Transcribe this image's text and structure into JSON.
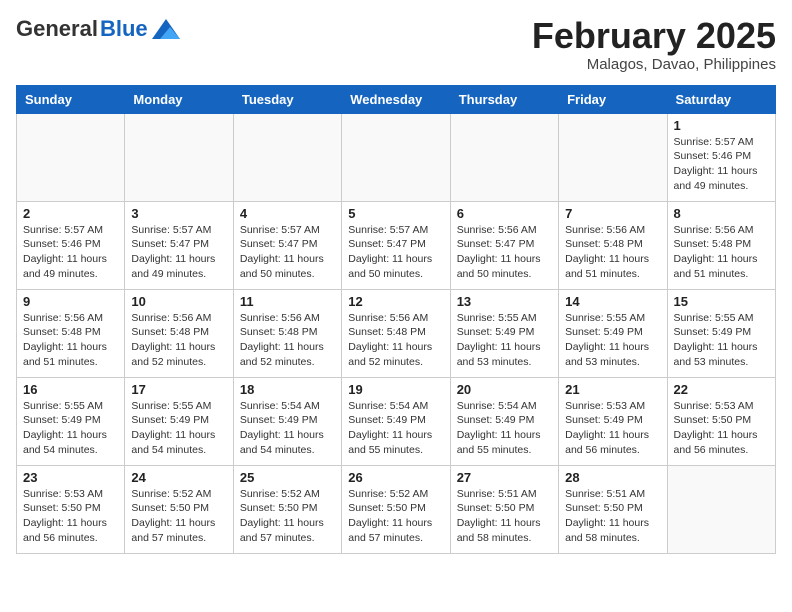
{
  "header": {
    "logo_general": "General",
    "logo_blue": "Blue",
    "month_title": "February 2025",
    "location": "Malagos, Davao, Philippines"
  },
  "weekdays": [
    "Sunday",
    "Monday",
    "Tuesday",
    "Wednesday",
    "Thursday",
    "Friday",
    "Saturday"
  ],
  "weeks": [
    [
      {
        "day": "",
        "info": ""
      },
      {
        "day": "",
        "info": ""
      },
      {
        "day": "",
        "info": ""
      },
      {
        "day": "",
        "info": ""
      },
      {
        "day": "",
        "info": ""
      },
      {
        "day": "",
        "info": ""
      },
      {
        "day": "1",
        "info": "Sunrise: 5:57 AM\nSunset: 5:46 PM\nDaylight: 11 hours\nand 49 minutes."
      }
    ],
    [
      {
        "day": "2",
        "info": "Sunrise: 5:57 AM\nSunset: 5:46 PM\nDaylight: 11 hours\nand 49 minutes."
      },
      {
        "day": "3",
        "info": "Sunrise: 5:57 AM\nSunset: 5:47 PM\nDaylight: 11 hours\nand 49 minutes."
      },
      {
        "day": "4",
        "info": "Sunrise: 5:57 AM\nSunset: 5:47 PM\nDaylight: 11 hours\nand 50 minutes."
      },
      {
        "day": "5",
        "info": "Sunrise: 5:57 AM\nSunset: 5:47 PM\nDaylight: 11 hours\nand 50 minutes."
      },
      {
        "day": "6",
        "info": "Sunrise: 5:56 AM\nSunset: 5:47 PM\nDaylight: 11 hours\nand 50 minutes."
      },
      {
        "day": "7",
        "info": "Sunrise: 5:56 AM\nSunset: 5:48 PM\nDaylight: 11 hours\nand 51 minutes."
      },
      {
        "day": "8",
        "info": "Sunrise: 5:56 AM\nSunset: 5:48 PM\nDaylight: 11 hours\nand 51 minutes."
      }
    ],
    [
      {
        "day": "9",
        "info": "Sunrise: 5:56 AM\nSunset: 5:48 PM\nDaylight: 11 hours\nand 51 minutes."
      },
      {
        "day": "10",
        "info": "Sunrise: 5:56 AM\nSunset: 5:48 PM\nDaylight: 11 hours\nand 52 minutes."
      },
      {
        "day": "11",
        "info": "Sunrise: 5:56 AM\nSunset: 5:48 PM\nDaylight: 11 hours\nand 52 minutes."
      },
      {
        "day": "12",
        "info": "Sunrise: 5:56 AM\nSunset: 5:48 PM\nDaylight: 11 hours\nand 52 minutes."
      },
      {
        "day": "13",
        "info": "Sunrise: 5:55 AM\nSunset: 5:49 PM\nDaylight: 11 hours\nand 53 minutes."
      },
      {
        "day": "14",
        "info": "Sunrise: 5:55 AM\nSunset: 5:49 PM\nDaylight: 11 hours\nand 53 minutes."
      },
      {
        "day": "15",
        "info": "Sunrise: 5:55 AM\nSunset: 5:49 PM\nDaylight: 11 hours\nand 53 minutes."
      }
    ],
    [
      {
        "day": "16",
        "info": "Sunrise: 5:55 AM\nSunset: 5:49 PM\nDaylight: 11 hours\nand 54 minutes."
      },
      {
        "day": "17",
        "info": "Sunrise: 5:55 AM\nSunset: 5:49 PM\nDaylight: 11 hours\nand 54 minutes."
      },
      {
        "day": "18",
        "info": "Sunrise: 5:54 AM\nSunset: 5:49 PM\nDaylight: 11 hours\nand 54 minutes."
      },
      {
        "day": "19",
        "info": "Sunrise: 5:54 AM\nSunset: 5:49 PM\nDaylight: 11 hours\nand 55 minutes."
      },
      {
        "day": "20",
        "info": "Sunrise: 5:54 AM\nSunset: 5:49 PM\nDaylight: 11 hours\nand 55 minutes."
      },
      {
        "day": "21",
        "info": "Sunrise: 5:53 AM\nSunset: 5:49 PM\nDaylight: 11 hours\nand 56 minutes."
      },
      {
        "day": "22",
        "info": "Sunrise: 5:53 AM\nSunset: 5:50 PM\nDaylight: 11 hours\nand 56 minutes."
      }
    ],
    [
      {
        "day": "23",
        "info": "Sunrise: 5:53 AM\nSunset: 5:50 PM\nDaylight: 11 hours\nand 56 minutes."
      },
      {
        "day": "24",
        "info": "Sunrise: 5:52 AM\nSunset: 5:50 PM\nDaylight: 11 hours\nand 57 minutes."
      },
      {
        "day": "25",
        "info": "Sunrise: 5:52 AM\nSunset: 5:50 PM\nDaylight: 11 hours\nand 57 minutes."
      },
      {
        "day": "26",
        "info": "Sunrise: 5:52 AM\nSunset: 5:50 PM\nDaylight: 11 hours\nand 57 minutes."
      },
      {
        "day": "27",
        "info": "Sunrise: 5:51 AM\nSunset: 5:50 PM\nDaylight: 11 hours\nand 58 minutes."
      },
      {
        "day": "28",
        "info": "Sunrise: 5:51 AM\nSunset: 5:50 PM\nDaylight: 11 hours\nand 58 minutes."
      },
      {
        "day": "",
        "info": ""
      }
    ]
  ]
}
